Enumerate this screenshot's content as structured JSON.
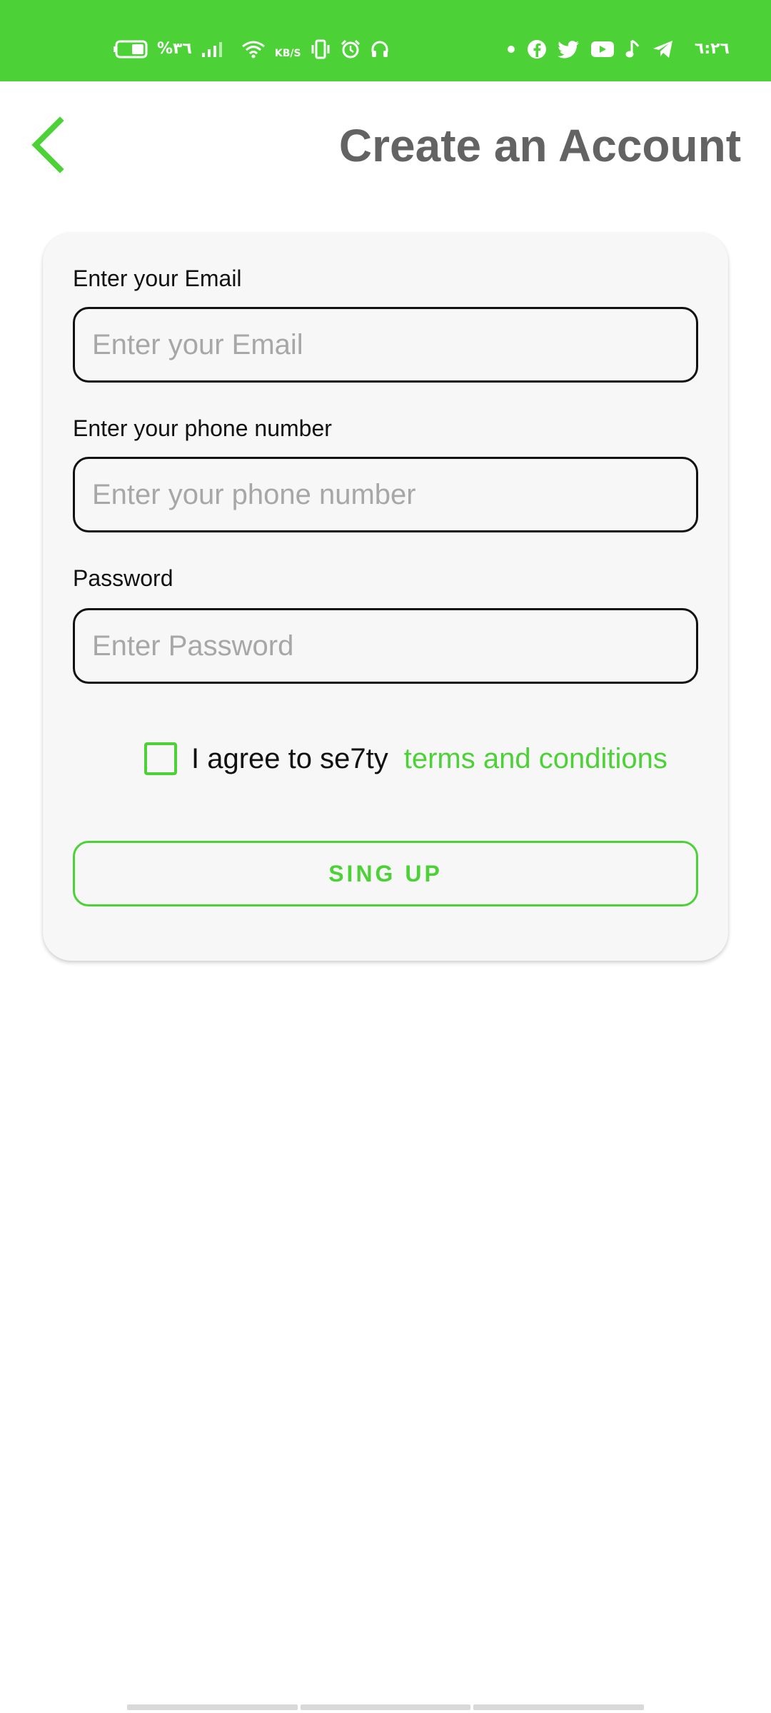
{
  "status_bar": {
    "battery_percent": "%٣٦",
    "speed_unit": "KB/S",
    "time": "٦:٢٦",
    "left_icons": [
      "battery-icon",
      "signal-icon",
      "wifi-icon",
      "vibrate-icon",
      "alarm-icon",
      "headphones-icon"
    ],
    "right_icons": [
      "notification-dot-icon",
      "facebook-icon",
      "twitter-icon",
      "youtube-icon",
      "music-note-icon",
      "telegram-icon"
    ],
    "background_color": "#4cd137"
  },
  "header": {
    "title": "Create an Account",
    "back_icon": "chevron-left-icon"
  },
  "form": {
    "email": {
      "label": "Enter your Email",
      "placeholder": "Enter your Email",
      "value": ""
    },
    "phone": {
      "label": "Enter your phone number",
      "placeholder": "Enter your phone number",
      "value": ""
    },
    "password": {
      "label": "Password",
      "placeholder": "Enter Password",
      "value": ""
    },
    "agree": {
      "checked": false,
      "text": "I agree to se7ty",
      "link_text": "terms and conditions"
    },
    "submit_label": "SING UP"
  },
  "colors": {
    "accent": "#4cd137",
    "title": "#636363",
    "card_background": "#f7f7f7",
    "input_border": "#111111",
    "placeholder": "#a7a7a7"
  }
}
